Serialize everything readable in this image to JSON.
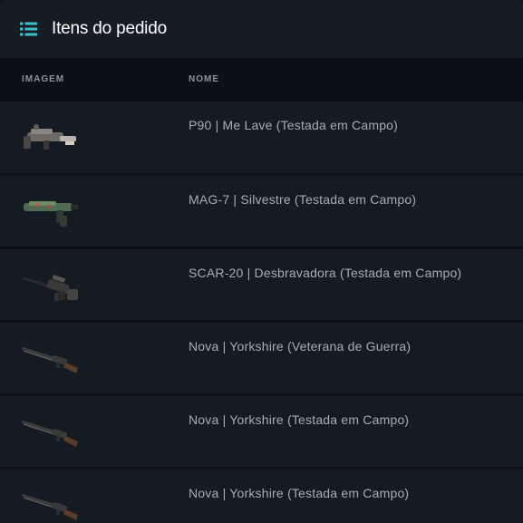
{
  "panel": {
    "title": "Itens do pedido",
    "icon": "list-icon",
    "accent": "#3fc1c9"
  },
  "table": {
    "columns": {
      "image": "IMAGEM",
      "name": "NOME"
    },
    "rows": [
      {
        "name": "P90 | Me Lave (Testada em Campo)",
        "icon": "p90-weapon-icon"
      },
      {
        "name": "MAG-7 | Silvestre (Testada em Campo)",
        "icon": "mag7-weapon-icon"
      },
      {
        "name": "SCAR-20 | Desbravadora (Testada em Campo)",
        "icon": "scar20-weapon-icon"
      },
      {
        "name": "Nova | Yorkshire (Veterana de Guerra)",
        "icon": "nova-weapon-icon"
      },
      {
        "name": "Nova | Yorkshire (Testada em Campo)",
        "icon": "nova-weapon-icon"
      },
      {
        "name": "Nova | Yorkshire (Testada em Campo)",
        "icon": "nova-weapon-icon"
      }
    ]
  }
}
